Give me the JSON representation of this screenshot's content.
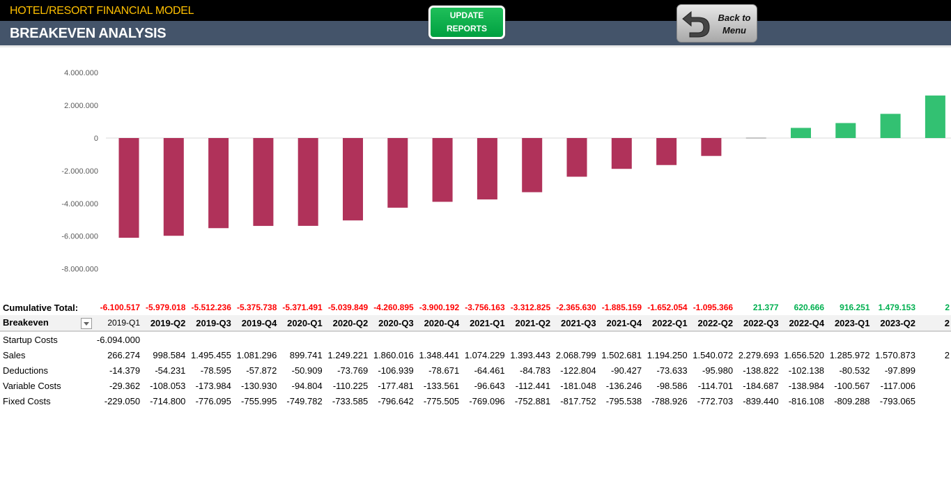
{
  "header": {
    "app_title": "HOTEL/RESORT FINANCIAL MODEL",
    "page_title": "BREAKEVEN ANALYSIS",
    "update_button": [
      "UPDATE",
      "REPORTS"
    ],
    "back_button": [
      "Back to",
      "Menu"
    ]
  },
  "colors": {
    "negative_bar": "#b0325a",
    "positive_bar": "#33c172",
    "negative_text": "#ff0000",
    "positive_text": "#00b050",
    "header_bg": "#44546a",
    "title_color": "#ffc000"
  },
  "chart_data": {
    "type": "bar",
    "categories": [
      "2019-Q1",
      "2019-Q2",
      "2019-Q3",
      "2019-Q4",
      "2020-Q1",
      "2020-Q2",
      "2020-Q3",
      "2020-Q4",
      "2021-Q1",
      "2021-Q2",
      "2021-Q3",
      "2021-Q4",
      "2022-Q1",
      "2022-Q2",
      "2022-Q3",
      "2022-Q4",
      "2023-Q1",
      "2023-Q2",
      "2023-Q3"
    ],
    "values": [
      -6100517,
      -5979018,
      -5512236,
      -5375738,
      -5371491,
      -5039849,
      -4260895,
      -3900192,
      -3756163,
      -3312825,
      -2365630,
      -1885159,
      -1652054,
      -1095366,
      21377,
      620666,
      916251,
      1479153,
      2600000
    ],
    "ylim": [
      -8000000,
      4000000
    ],
    "yticks": [
      "4.000.000",
      "2.000.000",
      "0",
      "-2.000.000",
      "-4.000.000",
      "-6.000.000",
      "-8.000.000"
    ],
    "grid": false
  },
  "table": {
    "cumulative_label": "Cumulative Total:",
    "cumulative": [
      "-6.100.517",
      "-5.979.018",
      "-5.512.236",
      "-5.375.738",
      "-5.371.491",
      "-5.039.849",
      "-4.260.895",
      "-3.900.192",
      "-3.756.163",
      "-3.312.825",
      "-2.365.630",
      "-1.885.159",
      "-1.652.054",
      "-1.095.366",
      "21.377",
      "620.666",
      "916.251",
      "1.479.153",
      "2"
    ],
    "header_label": "Breakeven",
    "columns": [
      "2019-Q1",
      "2019-Q2",
      "2019-Q3",
      "2019-Q4",
      "2020-Q1",
      "2020-Q2",
      "2020-Q3",
      "2020-Q4",
      "2021-Q1",
      "2021-Q2",
      "2021-Q3",
      "2021-Q4",
      "2022-Q1",
      "2022-Q2",
      "2022-Q3",
      "2022-Q4",
      "2023-Q1",
      "2023-Q2",
      "2"
    ],
    "rows": [
      {
        "label": "Startup Costs",
        "values": [
          "-6.094.000",
          "",
          "",
          "",
          "",
          "",
          "",
          "",
          "",
          "",
          "",
          "",
          "",
          "",
          "",
          "",
          "",
          "",
          ""
        ]
      },
      {
        "label": "Sales",
        "values": [
          "266.274",
          "998.584",
          "1.495.455",
          "1.081.296",
          "899.741",
          "1.249.221",
          "1.860.016",
          "1.348.441",
          "1.074.229",
          "1.393.443",
          "2.068.799",
          "1.502.681",
          "1.194.250",
          "1.540.072",
          "2.279.693",
          "1.656.520",
          "1.285.972",
          "1.570.873",
          "2"
        ]
      },
      {
        "label": "Deductions",
        "values": [
          "-14.379",
          "-54.231",
          "-78.595",
          "-57.872",
          "-50.909",
          "-73.769",
          "-106.939",
          "-78.671",
          "-64.461",
          "-84.783",
          "-122.804",
          "-90.427",
          "-73.633",
          "-95.980",
          "-138.822",
          "-102.138",
          "-80.532",
          "-97.899",
          ""
        ]
      },
      {
        "label": "Variable Costs",
        "values": [
          "-29.362",
          "-108.053",
          "-173.984",
          "-130.930",
          "-94.804",
          "-110.225",
          "-177.481",
          "-133.561",
          "-96.643",
          "-112.441",
          "-181.048",
          "-136.246",
          "-98.586",
          "-114.701",
          "-184.687",
          "-138.984",
          "-100.567",
          "-117.006",
          ""
        ]
      },
      {
        "label": "Fixed Costs",
        "values": [
          "-229.050",
          "-714.800",
          "-776.095",
          "-755.995",
          "-749.782",
          "-733.585",
          "-796.642",
          "-775.505",
          "-769.096",
          "-752.881",
          "-817.752",
          "-795.538",
          "-788.926",
          "-772.703",
          "-839.440",
          "-816.108",
          "-809.288",
          "-793.065",
          ""
        ]
      }
    ]
  }
}
